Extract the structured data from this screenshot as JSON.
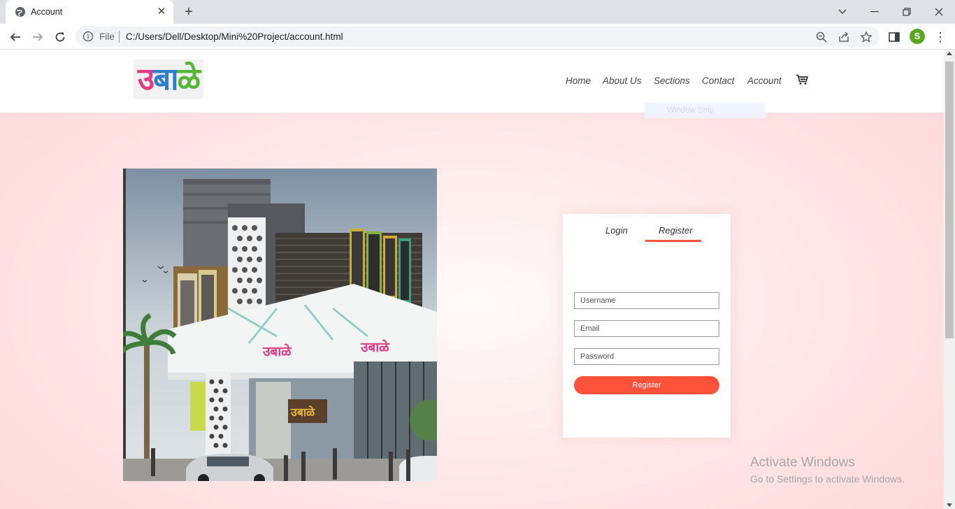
{
  "browser": {
    "tab_title": "Account",
    "tab_close": "✕",
    "new_tab": "+",
    "address_prefix": "File",
    "address_url": "C:/Users/Dell/Desktop/Mini%20Project/account.html",
    "profile_initial": "S",
    "menu_glyph": "⋮",
    "window_controls": {
      "minimize": "—",
      "restore": "❐",
      "close": "✕"
    }
  },
  "header": {
    "logo_text": {
      "part1": "उ",
      "part2": "बा",
      "part3": "ळे"
    },
    "nav": [
      "Home",
      "About Us",
      "Sections",
      "Contact",
      "Account"
    ],
    "cart_icon": "cart-icon"
  },
  "overlay": {
    "snip_label": "Window Snip"
  },
  "form": {
    "tabs": [
      "Login",
      "Register"
    ],
    "active_tab": "Register",
    "username_placeholder": "Username",
    "email_placeholder": "Email",
    "password_placeholder": "Password",
    "submit_label": "Register"
  },
  "watermark": {
    "title": "Activate Windows",
    "subtitle": "Go to Settings to activate Windows."
  },
  "colors": {
    "accent": "#ff523b",
    "page_bg": "#ffd7d9"
  }
}
